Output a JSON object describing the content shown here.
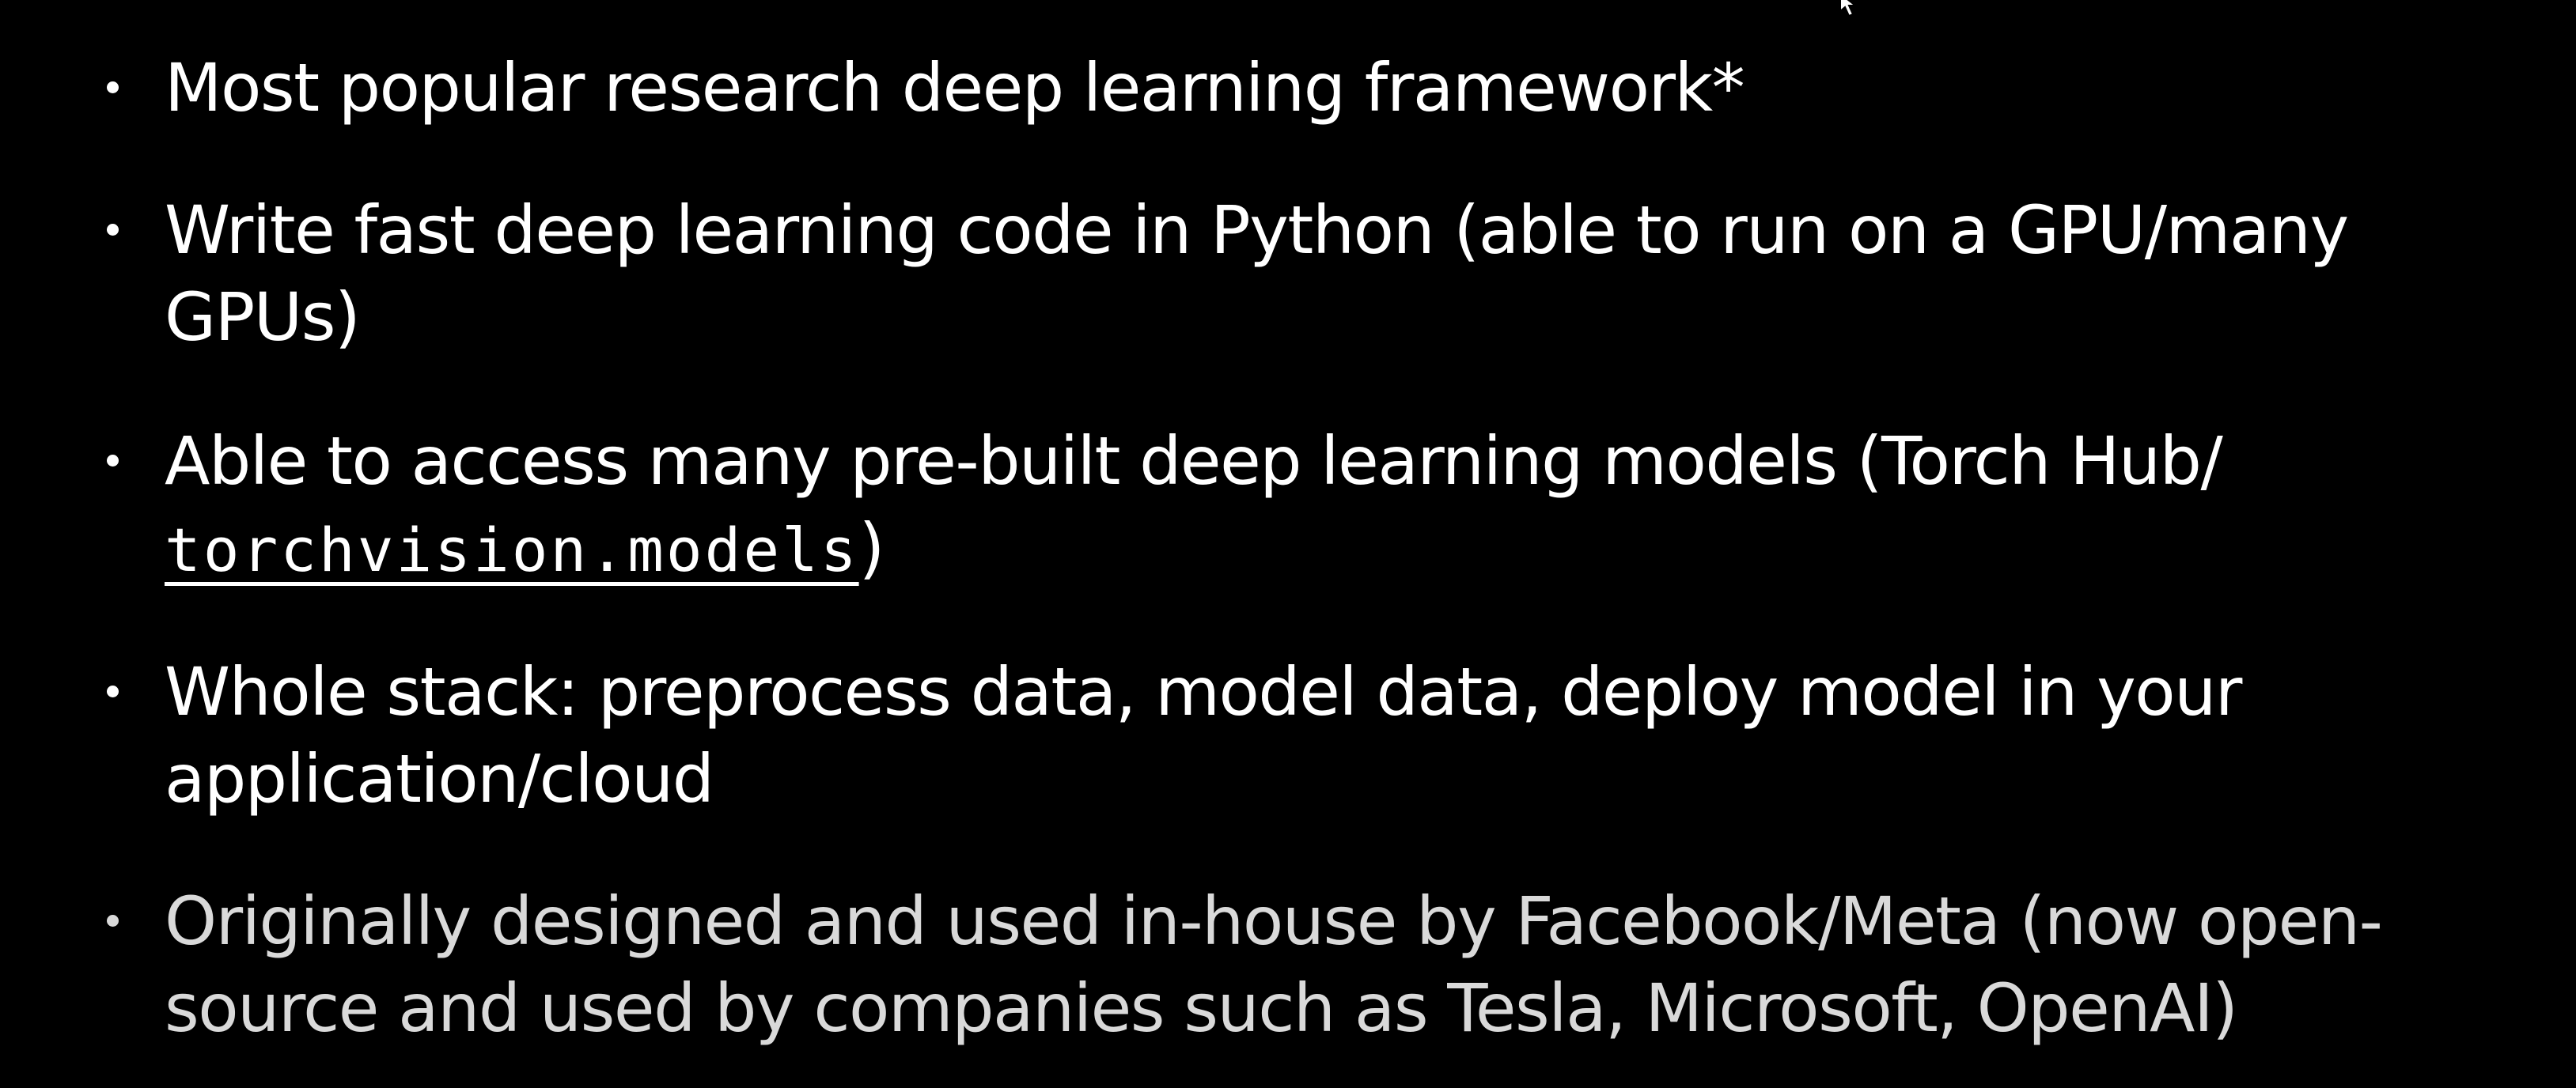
{
  "colors": {
    "background": "#000000",
    "text": "#ffffff",
    "text_dim": "#d9d9d9"
  },
  "bullets": [
    {
      "text": "Most popular research deep learning framework*"
    },
    {
      "text": "Write fast deep learning code in Python (able to run on a GPU/many GPUs)"
    },
    {
      "text_before": "Able to access many pre-built deep learning models (Torch Hub/ ",
      "code": "torchvision.models",
      "text_after": ")"
    },
    {
      "text": "Whole stack: preprocess data, model data, deploy model in your application/cloud"
    },
    {
      "text": "Originally designed and used in-house by Facebook/Meta (now open-source and used by companies such as Tesla, Microsoft, OpenAI)"
    }
  ],
  "cursor_icon": "mouse-pointer-icon"
}
